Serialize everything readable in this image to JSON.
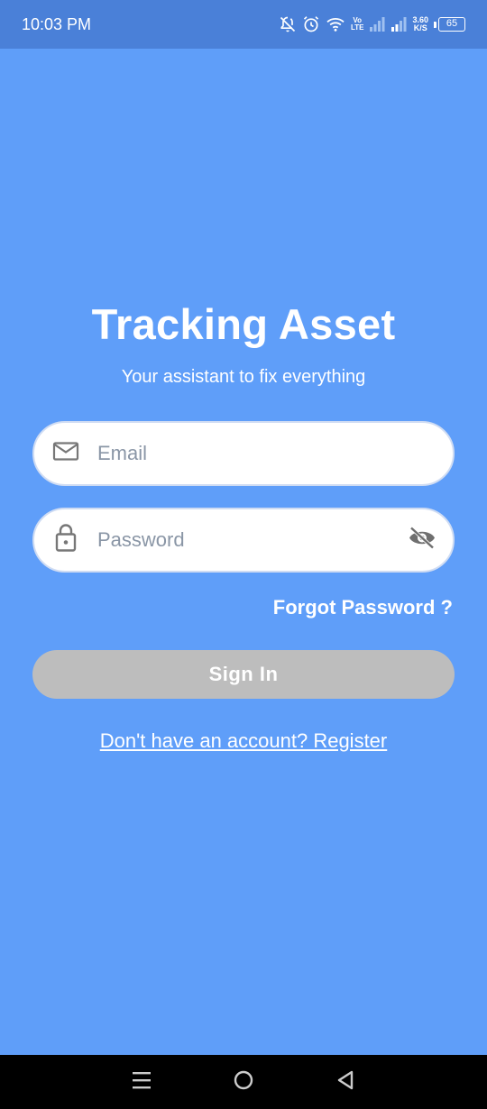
{
  "status_bar": {
    "time": "10:03 PM",
    "volte_top": "Vo",
    "volte_bottom": "LTE",
    "speed_value": "3.60",
    "speed_unit": "K/S",
    "battery": "65"
  },
  "login": {
    "title": "Tracking Asset",
    "subtitle": "Your assistant to fix everything",
    "email_placeholder": "Email",
    "password_placeholder": "Password",
    "forgot_password": "Forgot Password ?",
    "sign_in": "Sign In",
    "register_text": "Don't have an account? Register"
  },
  "colors": {
    "background": "#5f9ef9",
    "status_bar": "#4a80d8",
    "button_disabled": "#bdbdbd",
    "nav_bar": "#000000"
  },
  "icons": {
    "email": "mail-icon",
    "password": "lock-icon",
    "visibility": "eye-off-icon",
    "nav_recents": "menu-icon",
    "nav_home": "home-circle-icon",
    "nav_back": "back-triangle-icon"
  }
}
